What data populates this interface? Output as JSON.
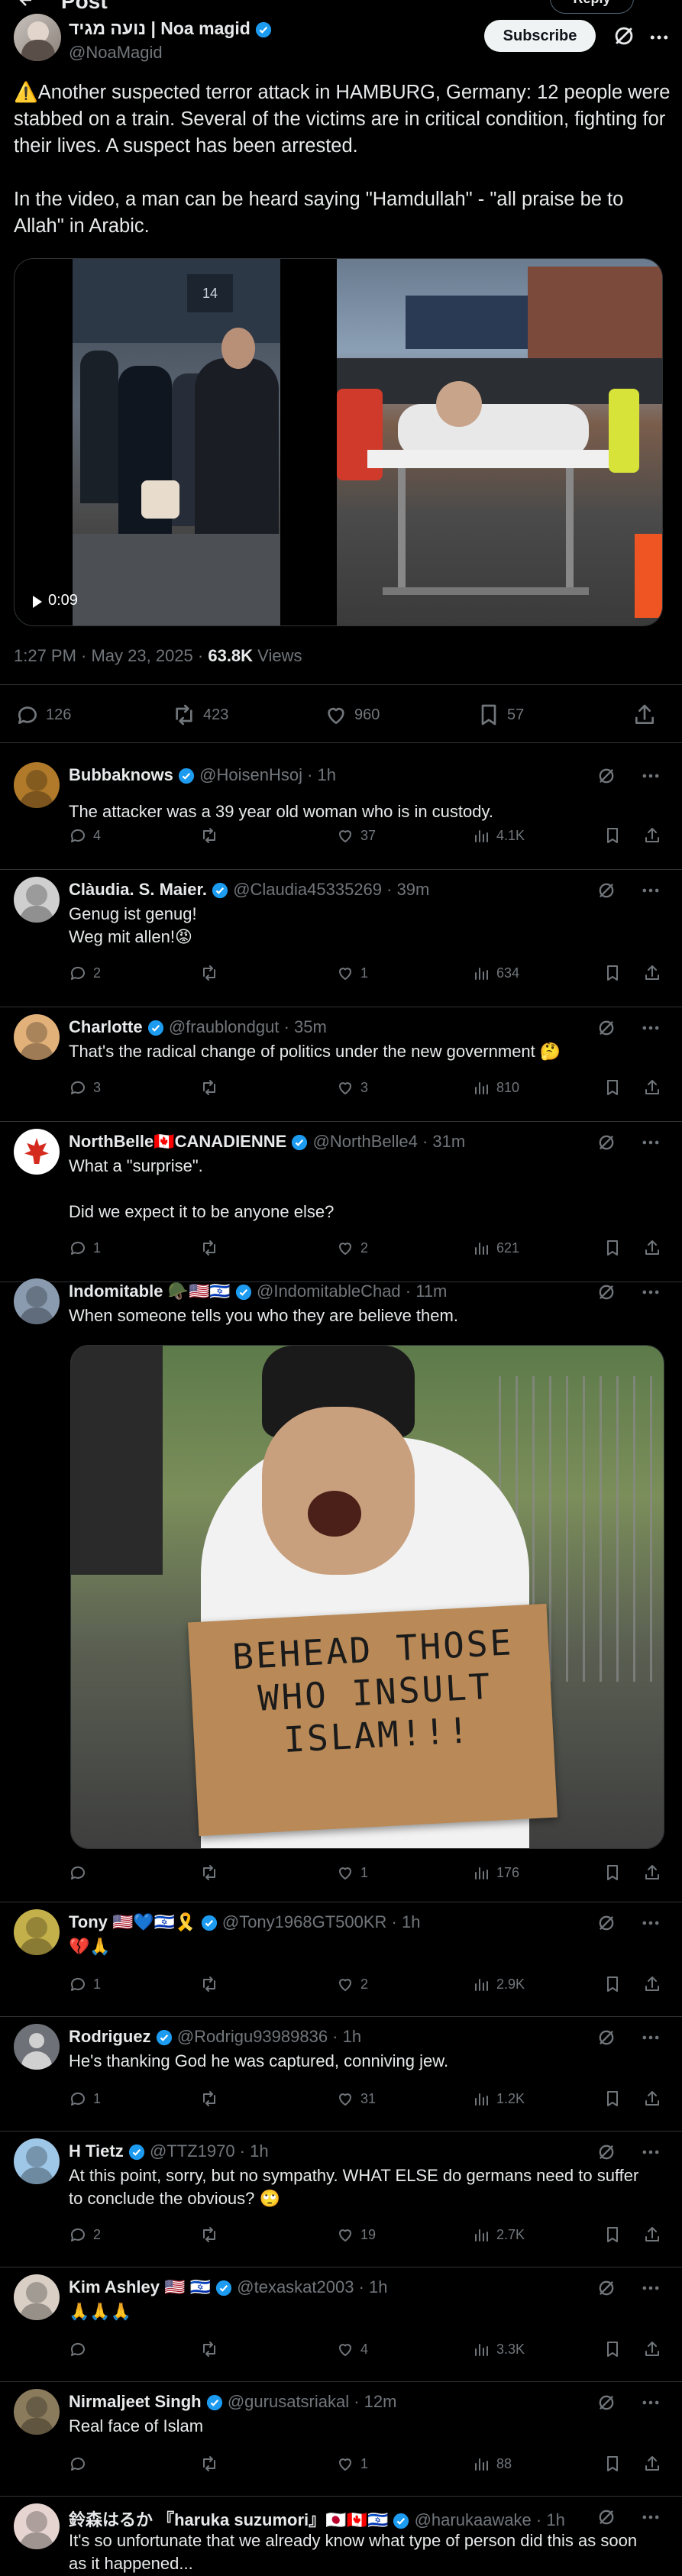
{
  "header": {
    "title": "Post",
    "reply_label": "Reply"
  },
  "post": {
    "author_name": "נועה מגיד | Noa magid",
    "author_handle": "@NoaMagid",
    "subscribe_label": "Subscribe",
    "text_p1": "⚠️Another suspected terror attack in HAMBURG, Germany: 12 people were stabbed on a train. Several of the victims are in critical condition, fighting for their lives. A suspect has been arrested.",
    "text_p2": "In the video, a man can be heard saying \"Hamdullah\" - \"all praise be to Allah\" in Arabic.",
    "video_duration": "0:09",
    "timestamp": "1:27 PM · May 23, 2025 · ",
    "views_count": "63.8K",
    "views_label": " Views",
    "stats": {
      "replies": "126",
      "reposts": "423",
      "likes": "960",
      "bookmarks": "57"
    }
  },
  "replies": [
    {
      "name": "Bubbaknows",
      "handle": "@HoisenHsoj · 1h",
      "text": "The attacker was a 39 year old woman who is in custody.",
      "replies": "4",
      "reposts": "",
      "likes": "37",
      "views": "4.1K"
    },
    {
      "name": "Clàudia. S. Maier.",
      "handle": "@Claudia45335269 · 39m",
      "text": "Genug ist genug!\nWeg mit allen!😡",
      "replies": "2",
      "reposts": "",
      "likes": "1",
      "views": "634"
    },
    {
      "name": "Charlotte",
      "handle": "@fraublondgut · 35m",
      "text": "That's the radical change of politics under the new government 🤔",
      "replies": "3",
      "reposts": "",
      "likes": "3",
      "views": "810"
    },
    {
      "name": "NorthBelle🇨🇦CANADIENNE",
      "handle": "@NorthBelle4 · 31m",
      "text": "What a \"surprise\".\n\nDid we expect it to be anyone else?",
      "replies": "1",
      "reposts": "",
      "likes": "2",
      "views": "621"
    },
    {
      "name": "Indomitable 🪖🇺🇸🇮🇱",
      "handle": "@IndomitableChad · 11m",
      "text": "When someone tells you who they are believe them.",
      "image_sign": "BEHEAD THOSE WHO INSULT ISLAM!!!",
      "replies": "",
      "reposts": "",
      "likes": "1",
      "views": "176"
    },
    {
      "name": "Tony 🇺🇸💙🇮🇱🎗️",
      "handle": "@Tony1968GT500KR · 1h",
      "text": "💔🙏",
      "replies": "1",
      "reposts": "",
      "likes": "2",
      "views": "2.9K"
    },
    {
      "name": "Rodriguez",
      "handle": "@Rodrigu93989836 · 1h",
      "text": "He's thanking God he was captured, conniving jew.",
      "replies": "1",
      "reposts": "",
      "likes": "31",
      "views": "1.2K"
    },
    {
      "name": "H Tietz",
      "handle": "@TTZ1970 · 1h",
      "text": "At this point, sorry, but no sympathy. WHAT ELSE do germans need to suffer to conclude the obvious? 🙄",
      "replies": "2",
      "reposts": "",
      "likes": "19",
      "views": "2.7K"
    },
    {
      "name": "Kim Ashley 🇺🇸 🇮🇱",
      "handle": "@texaskat2003 · 1h",
      "text": "🙏🙏🙏",
      "replies": "",
      "reposts": "",
      "likes": "4",
      "views": "3.3K"
    },
    {
      "name": "Nirmaljeet Singh",
      "handle": "@gurusatsriakal · 12m",
      "text": "Real face of Islam",
      "replies": "",
      "reposts": "",
      "likes": "1",
      "views": "88"
    },
    {
      "name": "鈴森はるか 『haruka suzumori』🇯🇵🇨🇦🇮🇱",
      "handle": "@harukaawake · 1h",
      "text": "It's so unfortunate that we already know what type of person did this as soon as it happened..."
    }
  ]
}
